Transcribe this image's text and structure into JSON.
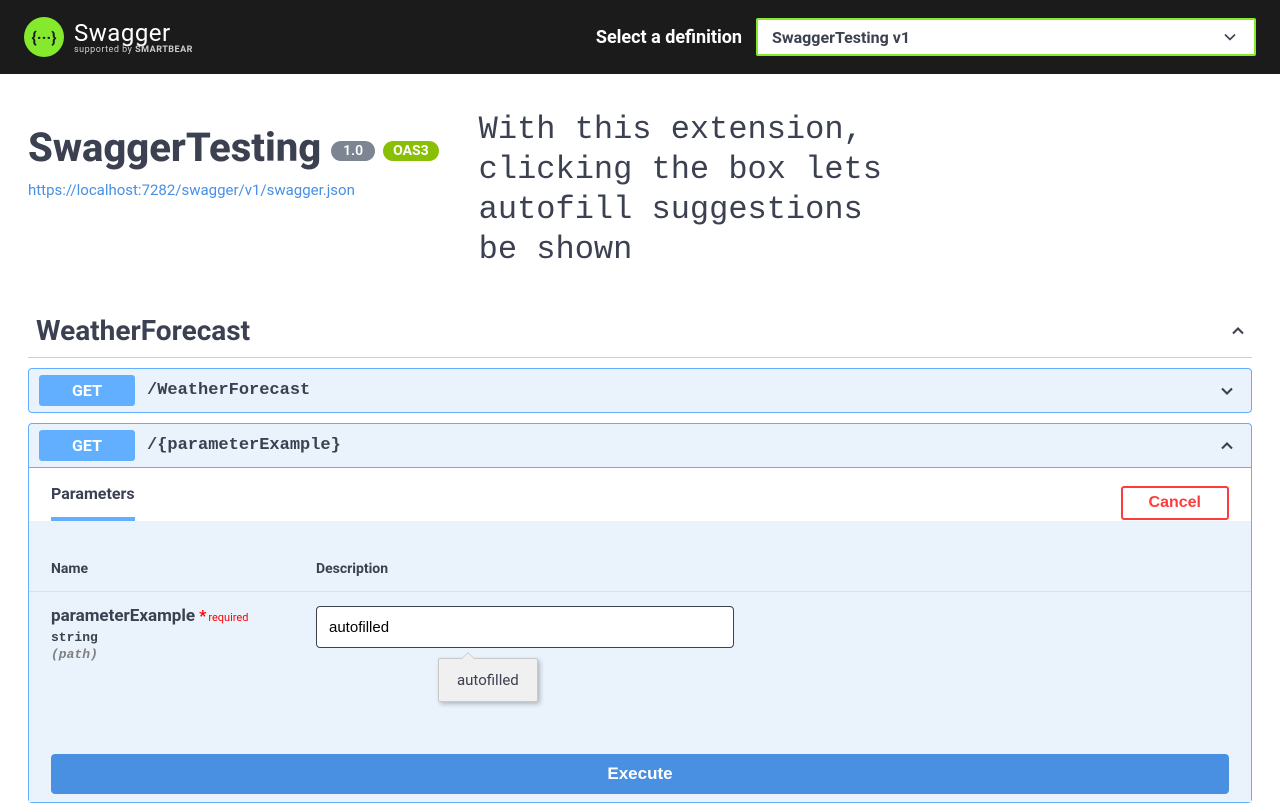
{
  "topbar": {
    "logo_glyph": "{···}",
    "logo_main": "Swagger",
    "logo_sub_prefix": "supported by ",
    "logo_sub_bold": "SMARTBEAR",
    "select_label": "Select a definition",
    "selected_def": "SwaggerTesting v1"
  },
  "header": {
    "title": "SwaggerTesting",
    "version_badge": "1.0",
    "oas_badge": "OAS3",
    "spec_url": "https://localhost:7282/swagger/v1/swagger.json"
  },
  "annotation_text": "With this extension,\nclicking the box lets\nautofill suggestions\nbe shown",
  "tag": {
    "name": "WeatherForecast"
  },
  "op1": {
    "method": "GET",
    "path": "/WeatherForecast"
  },
  "op2": {
    "method": "GET",
    "path": "/{parameterExample}",
    "params_title": "Parameters",
    "cancel_label": "Cancel",
    "col_name": "Name",
    "col_desc": "Description",
    "param": {
      "name": "parameterExample",
      "required_label": "required",
      "type": "string",
      "location": "(path)",
      "input_value": "autofilled"
    },
    "autofill_suggestion": "autofilled",
    "execute_label": "Execute"
  }
}
